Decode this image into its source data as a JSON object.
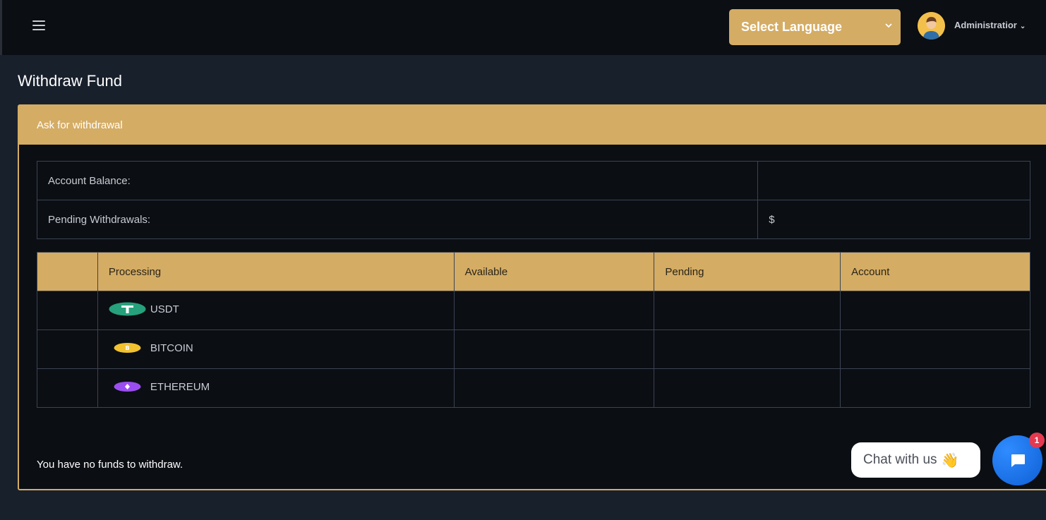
{
  "header": {
    "language_select": "Select Language",
    "user_name": "Administratior",
    "caret": "⌄"
  },
  "page": {
    "title": "Withdraw Fund"
  },
  "card": {
    "header": "Ask for withdrawal",
    "balance_rows": [
      {
        "label": "Account Balance:",
        "value": ""
      },
      {
        "label": "Pending Withdrawals:",
        "value": "$"
      }
    ],
    "table": {
      "columns": [
        "",
        "Processing",
        "Available",
        "Pending",
        "Account"
      ],
      "rows": [
        {
          "coin": "USDT",
          "icon": "tether-icon",
          "color": "#26a17b"
        },
        {
          "coin": "BITCOIN",
          "icon": "bitcoin-icon",
          "color": "#f2c230"
        },
        {
          "coin": "ETHEREUM",
          "icon": "ethereum-icon",
          "color": "#9b4ef0"
        }
      ]
    },
    "message": "You have no funds to withdraw."
  },
  "chat": {
    "label": "Chat with us",
    "wave": "👋",
    "badge": "1"
  },
  "colors": {
    "accent": "#d4ac64",
    "background": "#18202c",
    "panel": "#0b0e13",
    "chat_blue": "#1a73e8",
    "badge_red": "#e53950"
  }
}
